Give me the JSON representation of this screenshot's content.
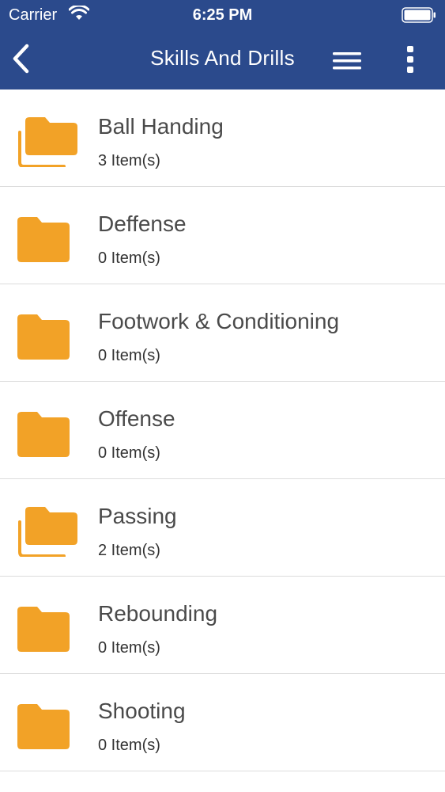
{
  "status_bar": {
    "carrier": "Carrier",
    "time": "6:25 PM"
  },
  "nav": {
    "title": "Skills And Drills",
    "back_icon": "chevron-left-icon",
    "menu_icon": "hamburger-icon",
    "more_icon": "vertical-ellipsis-icon",
    "color": "#2b4a8c"
  },
  "folder_color": "#f2a227",
  "folders": [
    {
      "name": "Ball Handing",
      "count": "3 Item(s)",
      "icon": "folders-stack-icon"
    },
    {
      "name": "Deffense",
      "count": "0 Item(s)",
      "icon": "folder-icon"
    },
    {
      "name": "Footwork & Conditioning",
      "count": "0 Item(s)",
      "icon": "folder-icon"
    },
    {
      "name": "Offense",
      "count": "0 Item(s)",
      "icon": "folder-icon"
    },
    {
      "name": "Passing",
      "count": "2 Item(s)",
      "icon": "folders-stack-icon"
    },
    {
      "name": "Rebounding",
      "count": "0 Item(s)",
      "icon": "folder-icon"
    },
    {
      "name": "Shooting",
      "count": "0 Item(s)",
      "icon": "folder-icon"
    }
  ]
}
